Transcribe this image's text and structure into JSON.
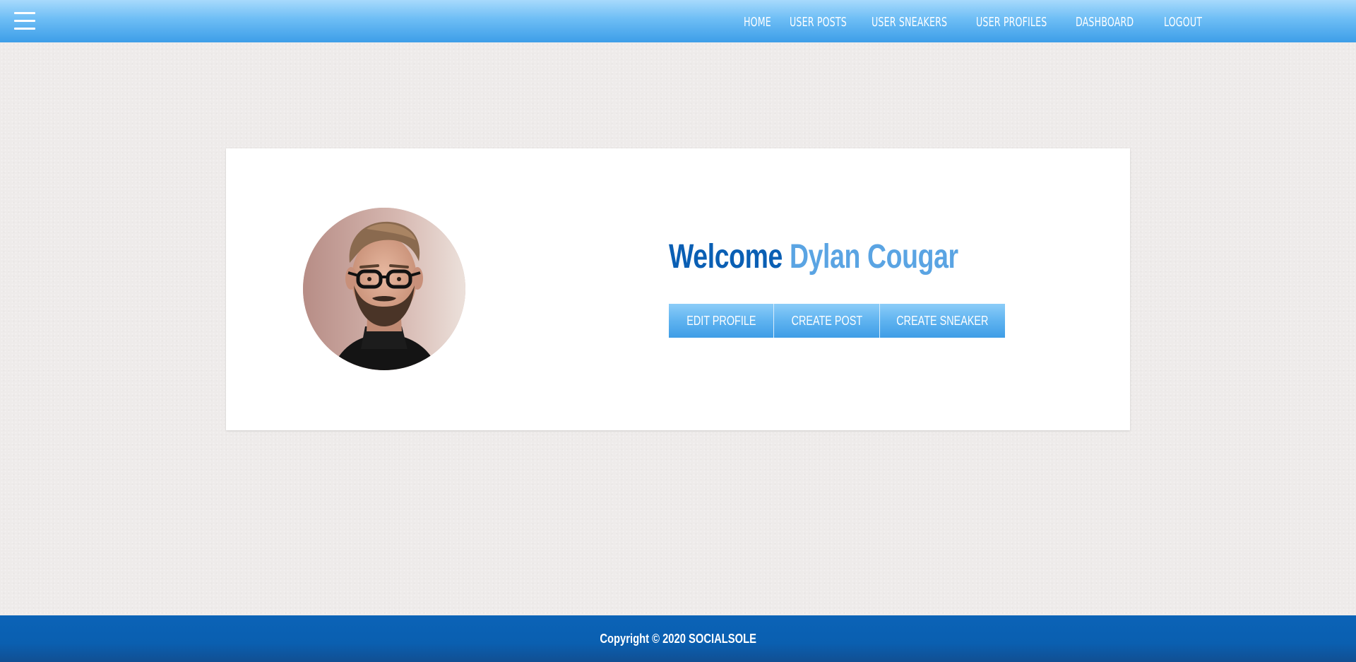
{
  "header": {
    "menu_icon": "hamburger-menu-icon",
    "nav": [
      {
        "label": "HOME"
      },
      {
        "label": "USER POSTS"
      },
      {
        "label": "USER SNEAKERS"
      },
      {
        "label": "USER PROFILES"
      },
      {
        "label": "DASHBOARD"
      },
      {
        "label": "LOGOUT"
      }
    ],
    "colors": {
      "bar_top": "#a7dafc",
      "bar_bottom": "#3d9ee8"
    }
  },
  "profile": {
    "welcome_word": "Welcome",
    "user_name": "Dylan Cougar",
    "avatar_icon": "user-avatar-photo",
    "actions": {
      "edit_profile": "EDIT PROFILE",
      "create_post": "CREATE POST",
      "create_sneaker": "CREATE SNEAKER"
    },
    "colors": {
      "welcome": "#0a5fb4",
      "name": "#5aa4e3",
      "button": "#5fb3f0"
    }
  },
  "footer": {
    "copyright": "Copyright © 2020 SOCIALSOLE",
    "color": "#0a5fb0"
  }
}
